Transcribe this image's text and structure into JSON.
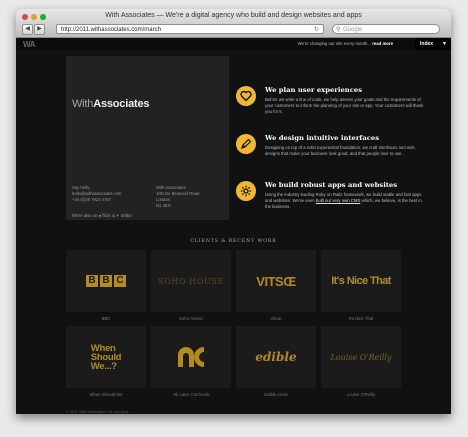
{
  "browser": {
    "title": "With Associates — We're a digital agency who build and design websites and apps",
    "url": "http://2011.withassociates.com/march",
    "search_placeholder": "Google"
  },
  "site": {
    "logo": "WA",
    "topstrip_text": "We're changing our site every month...",
    "topstrip_link": "read more",
    "index_label": "Index",
    "brand_prefix": "With",
    "brand_suffix": "Associates",
    "contact": {
      "greeting": "Say hello,",
      "email": "hello@withassociates.com",
      "phone": "+44 (0)20 7923 4767"
    },
    "address": {
      "line1": "With Associates",
      "line2": "10G De Beauvoir Road",
      "line3": "London",
      "line4": "N1 4EN"
    },
    "social": {
      "prefix": "We're also on",
      "flickr": "flickr",
      "amp": "&",
      "twitter": "twitter"
    },
    "features": [
      {
        "icon": "heart-icon",
        "title": "We plan user experiences",
        "body": "Before we write a line of code, we help assess your goals and the requirements of your customers to inform the planning of your site or app. Your customers will thank you for it."
      },
      {
        "icon": "pen-icon",
        "title": "We design intuitive interfaces",
        "body": "Designing on top of a solid experiential foundation, we craft interfaces and web designs that make your business look good, and that people love to use."
      },
      {
        "icon": "gear-icon",
        "title": "We build robust apps and websites",
        "body_before": "Using the industry leading Ruby on Rails framework, we build stable and fast apps and websites. We've even",
        "body_link": "built our very own CMS",
        "body_after": "which, we believe, is the best in the business."
      }
    ],
    "clients_heading": "CLIENTS & RECENT WORK",
    "clients": [
      {
        "logo": "BBC",
        "caption": "BBC"
      },
      {
        "logo": "SOHO HOUSE",
        "caption": "Soho House"
      },
      {
        "logo": "VITSŒ",
        "caption": "Vitsœ"
      },
      {
        "logo": "It's Nice That",
        "caption": "It's Nice That"
      },
      {
        "logo_line1": "When",
        "logo_line2": "Should",
        "logo_line3": "We...?",
        "caption": "When Should We"
      },
      {
        "logo": "",
        "caption": "Ok Later Cut brook"
      },
      {
        "logo": "edible",
        "caption": "Edible snow"
      },
      {
        "logo": "Louise O'Reilly",
        "caption": "Louise O'Reilly"
      }
    ],
    "footer": "© 2011 With Associates Ltd. All rights"
  },
  "colors": {
    "accent": "#f1b82d",
    "logo_gold": "#b38c1d",
    "background": "#111111",
    "panel": "#222222"
  }
}
